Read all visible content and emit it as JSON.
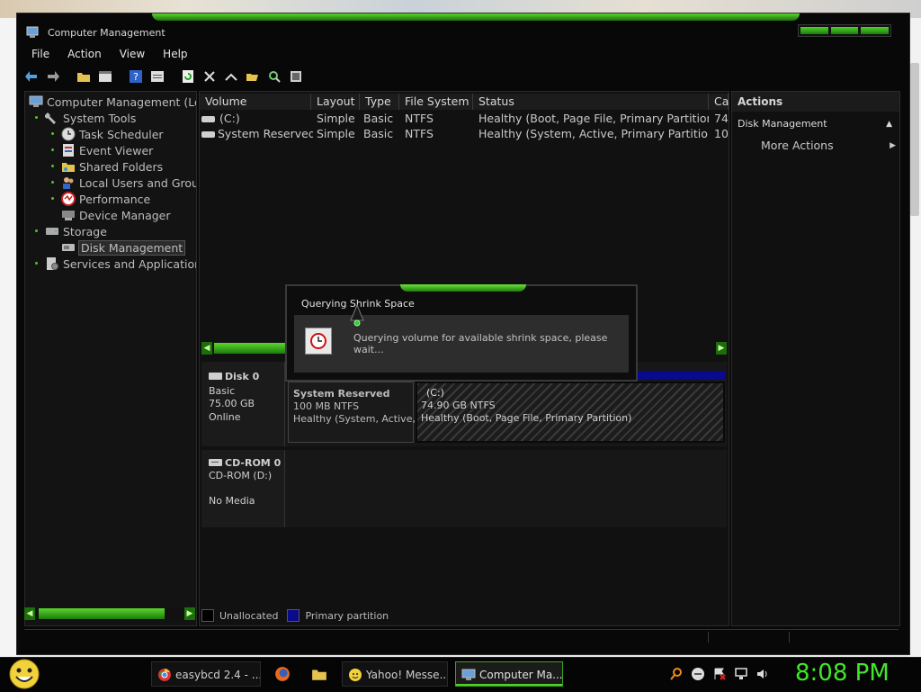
{
  "window": {
    "title": "Computer Management"
  },
  "menu": [
    "File",
    "Action",
    "View",
    "Help"
  ],
  "toolbar": [
    {
      "icon": "back-arrow-icon"
    },
    {
      "icon": "forward-arrow-icon"
    },
    {
      "icon": "folder-up-icon"
    },
    {
      "icon": "show-hide-console-tree-icon"
    },
    {
      "icon": "help-icon"
    },
    {
      "icon": "properties-icon"
    },
    {
      "icon": "refresh-icon"
    },
    {
      "icon": "delete-icon"
    },
    {
      "icon": "connect-icon"
    },
    {
      "icon": "open-folder-icon"
    },
    {
      "icon": "search-icon"
    },
    {
      "icon": "settings-icon"
    }
  ],
  "tree": {
    "root": "Computer Management (Loc",
    "system_tools": "System Tools",
    "task_scheduler": "Task Scheduler",
    "event_viewer": "Event Viewer",
    "shared_folders": "Shared Folders",
    "local_users": "Local Users and Grou",
    "performance": "Performance",
    "device_manager": "Device Manager",
    "storage": "Storage",
    "disk_management": "Disk Management",
    "services": "Services and Applications"
  },
  "volume_table": {
    "columns": [
      "Volume",
      "Layout",
      "Type",
      "File System",
      "Status",
      "Ca"
    ],
    "rows": [
      {
        "volume": "(C:)",
        "layout": "Simple",
        "type": "Basic",
        "fs": "NTFS",
        "status": "Healthy (Boot, Page File, Primary Partition)",
        "capacity": "74"
      },
      {
        "volume": "System Reserved",
        "layout": "Simple",
        "type": "Basic",
        "fs": "NTFS",
        "status": "Healthy (System, Active, Primary Partition)",
        "capacity": "10"
      }
    ]
  },
  "disks": {
    "disk0": {
      "name": "Disk 0",
      "type": "Basic",
      "size": "75.00 GB",
      "state": "Online",
      "partitions": [
        {
          "name": "System Reserved",
          "size": "100 MB NTFS",
          "status": "Healthy (System, Active, P"
        },
        {
          "name": "(C:)",
          "size": "74.90 GB NTFS",
          "status": "Healthy (Boot, Page File, Primary Partition)"
        }
      ]
    },
    "cdrom0": {
      "name": "CD-ROM 0",
      "drive": "CD-ROM (D:)",
      "media": "No Media"
    }
  },
  "legend": [
    {
      "label": "Unallocated",
      "color": "#000000"
    },
    {
      "label": "Primary partition",
      "color": "#0a0a8c"
    }
  ],
  "actions": {
    "header": "Actions",
    "section": "Disk Management",
    "more": "More Actions"
  },
  "dialog": {
    "title": "Querying Shrink Space",
    "message": "Querying volume for available shrink space, please wait..."
  },
  "taskbar": {
    "items": [
      "easybcd 2.4 - ...",
      "Yahoo! Messe...",
      "Computer Ma..."
    ],
    "clock": "8:08 PM"
  },
  "colors": {
    "accent": "#4fd02a",
    "clock": "#42e62a",
    "primary_partition": "#0a0a8c"
  }
}
